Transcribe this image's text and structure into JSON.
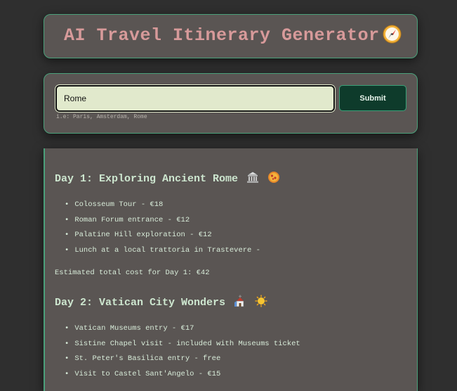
{
  "header": {
    "title": "AI Travel Itinerary Generator",
    "title_icon": "compass-icon"
  },
  "form": {
    "destination_value": "Rome",
    "destination_placeholder": "",
    "submit_label": "Submit",
    "hint": "i.e: Paris, Amsterdam, Rome"
  },
  "itinerary": {
    "days": [
      {
        "heading": "Day 1: Exploring Ancient Rome",
        "emojis": [
          "classical-building-icon",
          "pizza-icon"
        ],
        "items": [
          "Colosseum Tour - €18",
          "Roman Forum entrance - €12",
          "Palatine Hill exploration - €12",
          "Lunch at a local trattoria in Trastevere -"
        ],
        "total": "Estimated total cost for Day 1: €42"
      },
      {
        "heading": "Day 2: Vatican City Wonders",
        "emojis": [
          "church-icon",
          "sun-icon"
        ],
        "items": [
          "Vatican Museums entry - €17",
          "Sistine Chapel visit - included with Museums ticket",
          "St. Peter's Basilica entry - free",
          "Visit to Castel Sant'Angelo - €15"
        ]
      }
    ]
  },
  "colors": {
    "background": "#2f2f2f",
    "card": "#5a5553",
    "accent_border": "#4aa07a",
    "title": "#d79a9a",
    "text": "#d8ecd9",
    "input_bg": "#e1e9cc",
    "button_bg": "#0e3b2b"
  }
}
